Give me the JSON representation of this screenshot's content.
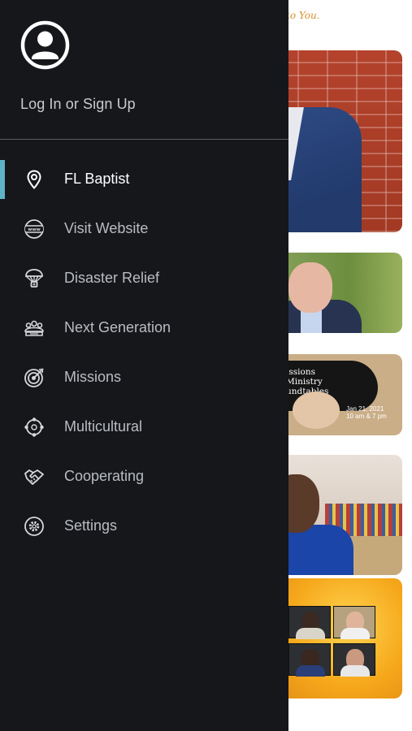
{
  "background": {
    "tagline": "to You.",
    "cards": [
      {
        "name": "feature-photo-man-brick-wall"
      },
      {
        "name": "feature-photo-man-smiling"
      },
      {
        "name": "feature-missions-ministry-roundtables",
        "title_lines": [
          "issions",
          "Ministry",
          "undtables"
        ],
        "detail_lines": [
          "Jan 21, 2021",
          "10 am & 7 pm"
        ]
      },
      {
        "name": "feature-video-speaker"
      },
      {
        "name": "feature-video-call-grid"
      }
    ]
  },
  "drawer": {
    "account": {
      "icon": "user-circle-icon",
      "label": "Log In or Sign Up"
    },
    "active_color": "#5fb3c8",
    "menu": [
      {
        "id": "fl-baptist",
        "label": "FL Baptist",
        "icon": "map-pin-icon",
        "active": true
      },
      {
        "id": "visit-website",
        "label": "Visit Website",
        "icon": "www-globe-icon",
        "active": false
      },
      {
        "id": "disaster-relief",
        "label": "Disaster Relief",
        "icon": "parachute-icon",
        "active": false
      },
      {
        "id": "next-generation",
        "label": "Next Generation",
        "icon": "group-icon",
        "active": false
      },
      {
        "id": "missions",
        "label": "Missions",
        "icon": "target-icon",
        "active": false
      },
      {
        "id": "multicultural",
        "label": "Multicultural",
        "icon": "people-circle-icon",
        "active": false
      },
      {
        "id": "cooperating",
        "label": "Cooperating",
        "icon": "handshake-icon",
        "active": false
      },
      {
        "id": "settings",
        "label": "Settings",
        "icon": "gear-icon",
        "active": false
      }
    ]
  }
}
